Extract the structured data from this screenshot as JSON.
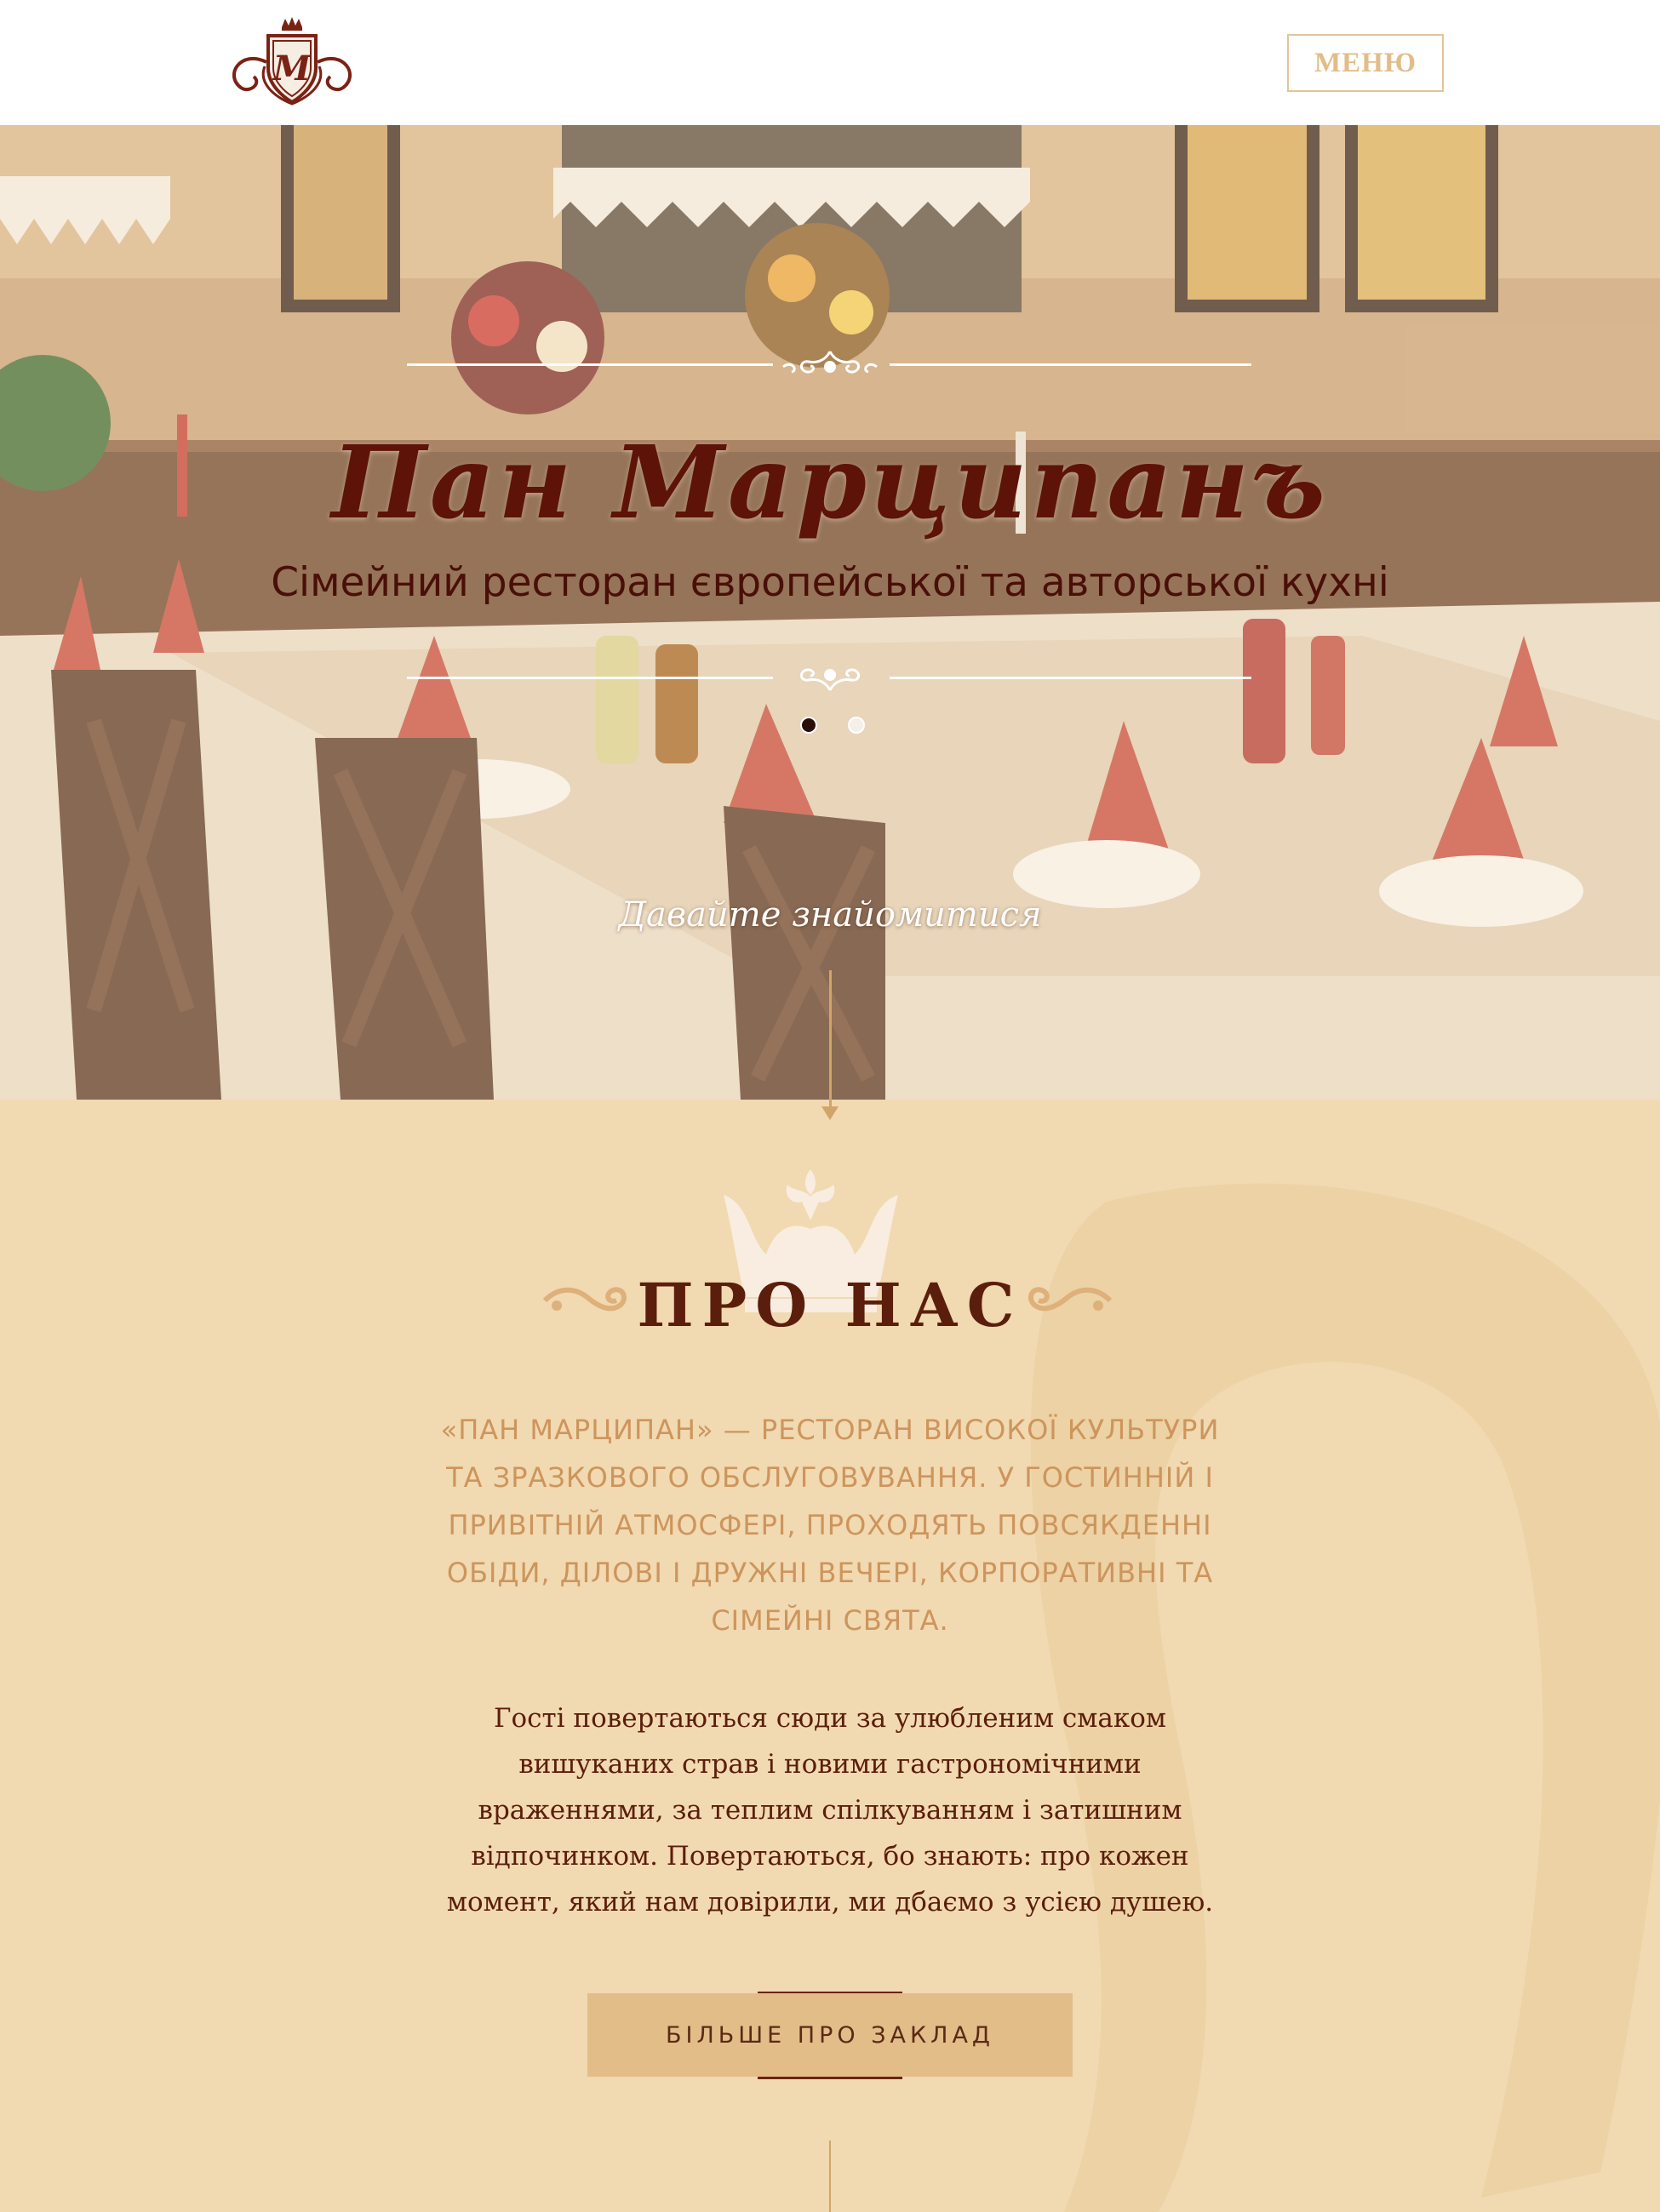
{
  "header": {
    "logo_letter": "M",
    "menu_label": "МЕНЮ"
  },
  "hero": {
    "title": "Пан Марципанъ",
    "subtitle": "Сімейний ресторан європейської та авторської кухні",
    "cta_text": "Давайте знайомитися",
    "slides": 2,
    "active_slide": 1
  },
  "about": {
    "title": "ПРО НАС",
    "lead": "«ПАН МАРЦИПАН» — РЕСТОРАН ВИСОКОЇ КУЛЬТУРИ ТА ЗРАЗКОВОГО ОБСЛУГОВУВАННЯ. У ГОСТИННІЙ І ПРИВІТНІЙ АТМОСФЕРІ, ПРОХОДЯТЬ ПОВСЯКДЕННІ ОБІДИ, ДІЛОВІ І ДРУЖНІ ВЕЧЕРІ, КОРПОРАТИВНІ ТА СІМЕЙНІ СВЯТА.",
    "body": "Гості повертаються сюди за улюбленим смаком вишуканих страв і новими гастрономічними враженнями, за теплим спілкуванням і затишним відпочинком. Повертаються, бо знають: про кожен момент, який нам довірили, ми дбаємо з усією душею.",
    "button_label": "БІЛЬШЕ ПРО ЗАКЛАД"
  },
  "colors": {
    "brand_dark": "#5e1308",
    "accent_gold": "#e3bd88",
    "section_bg": "#f1d9b1",
    "lead_text": "#cd955c"
  },
  "icons": [
    "logo-crest-icon",
    "crown-icon",
    "flourish-left-icon",
    "flourish-right-icon",
    "arrow-down-icon"
  ]
}
